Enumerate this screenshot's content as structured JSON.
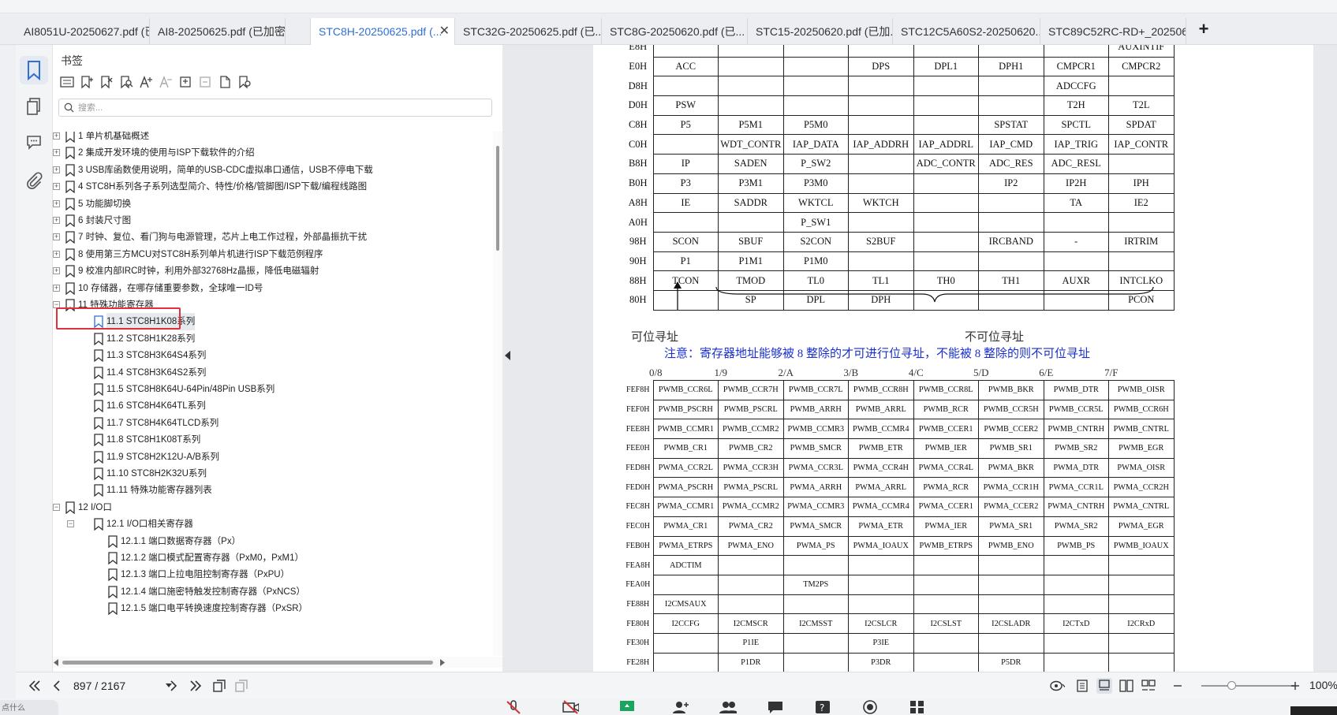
{
  "tabs": [
    {
      "label": "AI8051U-20250627.pdf (已..."
    },
    {
      "label": "AI8-20250625.pdf (已加密)"
    },
    {
      "label": "STC8H-20250625.pdf (..."
    },
    {
      "label": "STC32G-20250625.pdf (已..."
    },
    {
      "label": "STC8G-20250620.pdf (已..."
    },
    {
      "label": "STC15-20250620.pdf (已加..."
    },
    {
      "label": "STC12C5A60S2-20250620...."
    },
    {
      "label": "STC89C52RC-RD+_202506..."
    }
  ],
  "add_tab": "+",
  "close_tab": "✕",
  "sidebar": {
    "title": "书签",
    "search_placeholder": "搜索...",
    "tree": [
      {
        "label": "1 单片机基础概述",
        "level": 0
      },
      {
        "label": "2  集成开发环境的使用与ISP下载软件的介绍",
        "level": 0
      },
      {
        "label": "3  USB库函数使用说明，简单的USB-CDC虚拟串口通信，USB不停电下载",
        "level": 0
      },
      {
        "label": "4  STC8H系列各子系列选型简介、特性/价格/管脚图/ISP下载/编程线路图",
        "level": 0
      },
      {
        "label": "5  功能脚切换",
        "level": 0
      },
      {
        "label": "6  封装尺寸图",
        "level": 0
      },
      {
        "label": "7  时钟、复位、看门狗与电源管理，芯片上电工作过程，外部晶振抗干扰",
        "level": 0
      },
      {
        "label": "8  使用第三方MCU对STC8H系列单片机进行ISP下载范例程序",
        "level": 0
      },
      {
        "label": "9  校准内部IRC时钟，利用外部32768Hz晶振，降低电磁辐射",
        "level": 0
      },
      {
        "label": "10  存储器，在哪存储重要参数，全球唯一ID号",
        "level": 0
      },
      {
        "label": "11  特殊功能寄存器",
        "level": 0
      },
      {
        "label": "11.1  STC8H1K08系列",
        "level": 1
      },
      {
        "label": "11.2   STC8H1K28系列",
        "level": 1
      },
      {
        "label": "11.3   STC8H3K64S4系列",
        "level": 1
      },
      {
        "label": "11.4   STC8H3K64S2系列",
        "level": 1
      },
      {
        "label": "11.5   STC8H8K64U-64Pin/48Pin USB系列",
        "level": 1
      },
      {
        "label": "11.6   STC8H4K64TL系列",
        "level": 1
      },
      {
        "label": "11.7   STC8H4K64TLCD系列",
        "level": 1
      },
      {
        "label": "11.8   STC8H1K08T系列",
        "level": 1
      },
      {
        "label": "11.9   STC8H2K12U-A/B系列",
        "level": 1
      },
      {
        "label": "11.10   STC8H2K32U系列",
        "level": 1
      },
      {
        "label": "11.11   特殊功能寄存器列表",
        "level": 1
      },
      {
        "label": "12  I/O口",
        "level": 0
      },
      {
        "label": "12.1  I/O口相关寄存器",
        "level": 1
      },
      {
        "label": "12.1.1  端口数据寄存器（Px）",
        "level": 2
      },
      {
        "label": "12.1.2 端口模式配置寄存器（PxM0，PxM1）",
        "level": 2
      },
      {
        "label": "12.1.3 端口上拉电阻控制寄存器（PxPU）",
        "level": 2
      },
      {
        "label": "12.1.4 端口施密特触发控制寄存器（PxNCS）",
        "level": 2
      },
      {
        "label": "12.1.5  端口电平转换速度控制寄存器（PxSR）",
        "level": 2
      }
    ]
  },
  "doc": {
    "table1": [
      [
        "E8H",
        "",
        "",
        "",
        "",
        "",
        "",
        "",
        "AUXINTIF"
      ],
      [
        "E0H",
        "ACC",
        "",
        "",
        "DPS",
        "DPL1",
        "DPH1",
        "CMPCR1",
        "CMPCR2"
      ],
      [
        "D8H",
        "",
        "",
        "",
        "",
        "",
        "",
        "ADCCFG",
        ""
      ],
      [
        "D0H",
        "PSW",
        "",
        "",
        "",
        "",
        "",
        "T2H",
        "T2L"
      ],
      [
        "C8H",
        "P5",
        "P5M1",
        "P5M0",
        "",
        "",
        "SPSTAT",
        "SPCTL",
        "SPDAT"
      ],
      [
        "C0H",
        "",
        "WDT_CONTR",
        "IAP_DATA",
        "IAP_ADDRH",
        "IAP_ADDRL",
        "IAP_CMD",
        "IAP_TRIG",
        "IAP_CONTR"
      ],
      [
        "B8H",
        "IP",
        "SADEN",
        "P_SW2",
        "",
        "ADC_CONTR",
        "ADC_RES",
        "ADC_RESL",
        ""
      ],
      [
        "B0H",
        "P3",
        "P3M1",
        "P3M0",
        "",
        "",
        "IP2",
        "IP2H",
        "IPH"
      ],
      [
        "A8H",
        "IE",
        "SADDR",
        "WKTCL",
        "WKTCH",
        "",
        "",
        "TA",
        "IE2"
      ],
      [
        "A0H",
        "",
        "",
        "P_SW1",
        "",
        "",
        "",
        "",
        ""
      ],
      [
        "98H",
        "SCON",
        "SBUF",
        "S2CON",
        "S2BUF",
        "",
        "IRCBAND",
        "-",
        "IRTRIM"
      ],
      [
        "90H",
        "P1",
        "P1M1",
        "P1M0",
        "",
        "",
        "",
        "",
        ""
      ],
      [
        "88H",
        "TCON",
        "TMOD",
        "TL0",
        "TL1",
        "TH0",
        "TH1",
        "AUXR",
        "INTCLKO"
      ],
      [
        "80H",
        "",
        "SP",
        "DPL",
        "DPH",
        "",
        "",
        "",
        "PCON"
      ]
    ],
    "bit_label": "可位寻址",
    "nonbit_label": "不可位寻址",
    "note": "注意：寄存器地址能够被 8 整除的才可进行位寻址，不能被 8 整除的则不可位寻址",
    "header2": [
      "0/8",
      "1/9",
      "2/A",
      "3/B",
      "4/C",
      "5/D",
      "6/E",
      "7/F"
    ],
    "table2": [
      [
        "FEF8H",
        "PWMB_CCR6L",
        "PWMB_CCR7H",
        "PWMB_CCR7L",
        "PWMB_CCR8H",
        "PWMB_CCR8L",
        "PWMB_BKR",
        "PWMB_DTR",
        "PWMB_OISR"
      ],
      [
        "FEF0H",
        "PWMB_PSCRH",
        "PWMB_PSCRL",
        "PWMB_ARRH",
        "PWMB_ARRL",
        "PWMB_RCR",
        "PWMB_CCR5H",
        "PWMB_CCR5L",
        "PWMB_CCR6H"
      ],
      [
        "FEE8H",
        "PWMB_CCMR1",
        "PWMB_CCMR2",
        "PWMB_CCMR3",
        "PWMB_CCMR4",
        "PWMB_CCER1",
        "PWMB_CCER2",
        "PWMB_CNTRH",
        "PWMB_CNTRL"
      ],
      [
        "FEE0H",
        "PWMB_CR1",
        "PWMB_CR2",
        "PWMB_SMCR",
        "PWMB_ETR",
        "PWMB_IER",
        "PWMB_SR1",
        "PWMB_SR2",
        "PWMB_EGR"
      ],
      [
        "FED8H",
        "PWMA_CCR2L",
        "PWMA_CCR3H",
        "PWMA_CCR3L",
        "PWMA_CCR4H",
        "PWMA_CCR4L",
        "PWMA_BKR",
        "PWMA_DTR",
        "PWMA_OISR"
      ],
      [
        "FED0H",
        "PWMA_PSCRH",
        "PWMA_PSCRL",
        "PWMA_ARRH",
        "PWMA_ARRL",
        "PWMA_RCR",
        "PWMA_CCR1H",
        "PWMA_CCR1L",
        "PWMA_CCR2H"
      ],
      [
        "FEC8H",
        "PWMA_CCMR1",
        "PWMA_CCMR2",
        "PWMA_CCMR3",
        "PWMA_CCMR4",
        "PWMA_CCER1",
        "PWMA_CCER2",
        "PWMA_CNTRH",
        "PWMA_CNTRL"
      ],
      [
        "FEC0H",
        "PWMA_CR1",
        "PWMA_CR2",
        "PWMA_SMCR",
        "PWMA_ETR",
        "PWMA_IER",
        "PWMA_SR1",
        "PWMA_SR2",
        "PWMA_EGR"
      ],
      [
        "FEB0H",
        "PWMA_ETRPS",
        "PWMA_ENO",
        "PWMA_PS",
        "PWMA_IOAUX",
        "PWMB_ETRPS",
        "PWMB_ENO",
        "PWMB_PS",
        "PWMB_IOAUX"
      ],
      [
        "FEA8H",
        "ADCTIM",
        "",
        "",
        "",
        "",
        "",
        "",
        ""
      ],
      [
        "FEA0H",
        "",
        "",
        "TM2PS",
        "",
        "",
        "",
        "",
        ""
      ],
      [
        "FE88H",
        "I2CMSAUX",
        "",
        "",
        "",
        "",
        "",
        "",
        ""
      ],
      [
        "FE80H",
        "I2CCFG",
        "I2CMSCR",
        "I2CMSST",
        "I2CSLCR",
        "I2CSLST",
        "I2CSLADR",
        "I2CTxD",
        "I2CRxD"
      ],
      [
        "FE30H",
        "",
        "P1IE",
        "",
        "P3IE",
        "",
        "",
        "",
        ""
      ],
      [
        "FE28H",
        "",
        "P1DR",
        "",
        "P3DR",
        "",
        "P5DR",
        "",
        ""
      ]
    ]
  },
  "footer": {
    "page_display": "897 / 2167",
    "zoom": "100%"
  },
  "taskbar": {
    "left_text": "点什么"
  },
  "colors": {
    "accent": "#2f6fd6",
    "highlight": "#e0303c",
    "note": "#1a2fd0"
  }
}
